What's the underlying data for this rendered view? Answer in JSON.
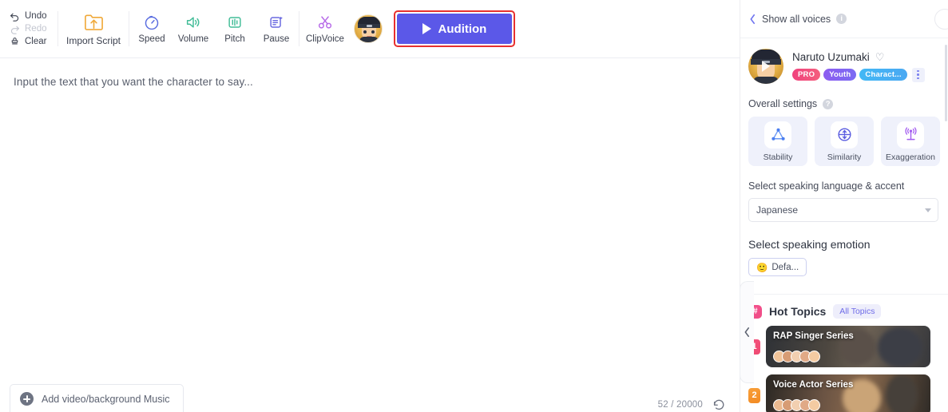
{
  "toolbar": {
    "undo": "Undo",
    "redo": "Redo",
    "clear": "Clear",
    "import_script": "Import Script",
    "speed": "Speed",
    "volume": "Volume",
    "pitch": "Pitch",
    "pause": "Pause",
    "clipvoice": "ClipVoice",
    "audition": "Audition",
    "audition_color": "#5b58e8",
    "highlight_color": "#e8302f"
  },
  "editor": {
    "placeholder": "Input the text that you want the character to say...",
    "add_media": "Add video/background Music",
    "char_count": "52 / 20000"
  },
  "panel": {
    "header": {
      "back_label": "Show all voices"
    },
    "voice": {
      "name": "Naruto Uzumaki",
      "badges": [
        {
          "label": "PRO",
          "color": "#f0417d"
        },
        {
          "label": "Youth",
          "color": "#8d5cf0"
        },
        {
          "label": "Charact...",
          "color": "#42b8f5"
        }
      ]
    },
    "overall_settings": {
      "title": "Overall settings",
      "items": [
        {
          "label": "Stability",
          "icon": "triangle-nodes-icon",
          "color": "#4a7ef0"
        },
        {
          "label": "Similarity",
          "icon": "similarity-circle-icon",
          "color": "#5a5ce0"
        },
        {
          "label": "Exaggeration",
          "icon": "antenna-broadcast-icon",
          "color": "#a35cf0"
        }
      ]
    },
    "language": {
      "label": "Select speaking language & accent",
      "value": "Japanese"
    },
    "emotion": {
      "label": "Select speaking emotion",
      "chip": "Defa...",
      "chip_emoji": "🙂"
    },
    "hot_topics": {
      "title": "Hot Topics",
      "all_topics": "All Topics",
      "hash": "#",
      "items": [
        {
          "rank": "1",
          "title": "RAP Singer Series"
        },
        {
          "rank": "2",
          "title": "Voice Actor Series"
        }
      ]
    }
  }
}
